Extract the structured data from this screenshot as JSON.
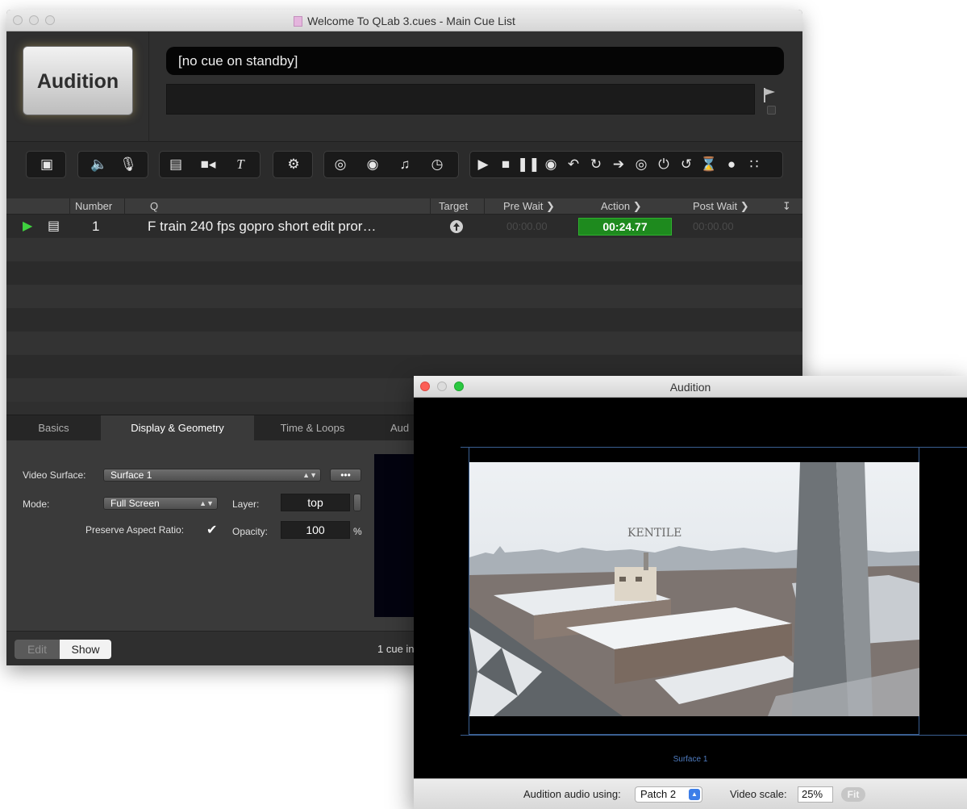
{
  "main_window": {
    "title": "Welcome To QLab 3.cues - Main Cue List",
    "go_button_label": "Audition",
    "standby_text": "[no cue on standby]",
    "toolbar_icons": [
      "stack-icon",
      "speaker-icon",
      "microphone-icon",
      "film-icon",
      "camera-icon",
      "text-icon",
      "mixer-icon",
      "target-icon",
      "globe-icon",
      "music-note-icon",
      "clock-icon",
      "play-icon",
      "stop-icon",
      "pause-icon",
      "record-icon",
      "undo-icon",
      "redo-icon",
      "arrow-right-icon",
      "target-go-icon",
      "power-icon",
      "loop-icon",
      "hourglass-icon",
      "speech-icon",
      "grid-icon"
    ]
  },
  "cue_list": {
    "columns": [
      "Number",
      "Q",
      "Target",
      "Pre Wait",
      "Action",
      "Post Wait"
    ],
    "rows": [
      {
        "number": "1",
        "name": "F train 240 fps gopro short edit pror…",
        "pre_wait": "00:00.00",
        "action": "00:24.77",
        "post_wait": "00:00.00"
      }
    ]
  },
  "inspector": {
    "tabs": [
      "Basics",
      "Display & Geometry",
      "Time & Loops",
      "Aud"
    ],
    "active_tab": "Display & Geometry",
    "video_surface_label": "Video Surface:",
    "video_surface_value": "Surface 1",
    "more_button": "•••",
    "mode_label": "Mode:",
    "mode_value": "Full Screen",
    "layer_label": "Layer:",
    "layer_value": "top",
    "preserve_aspect_label": "Preserve Aspect Ratio:",
    "preserve_aspect_checked": "✔",
    "opacity_label": "Opacity:",
    "opacity_value": "100",
    "opacity_unit": "%"
  },
  "bottom_bar": {
    "edit_label": "Edit",
    "show_label": "Show",
    "status_text": "1 cue in"
  },
  "audition_window": {
    "title": "Audition",
    "surface_label": "Surface 1",
    "photo_sign_text": "KENTILE",
    "audio_label": "Audition audio using:",
    "audio_value": "Patch 2",
    "video_scale_label": "Video scale:",
    "video_scale_value": "25%",
    "fit_label": "Fit"
  },
  "colors": {
    "action_highlight": "#1e8a1e",
    "play_green": "#3fd13f",
    "surface_outline": "#3a5f92"
  }
}
